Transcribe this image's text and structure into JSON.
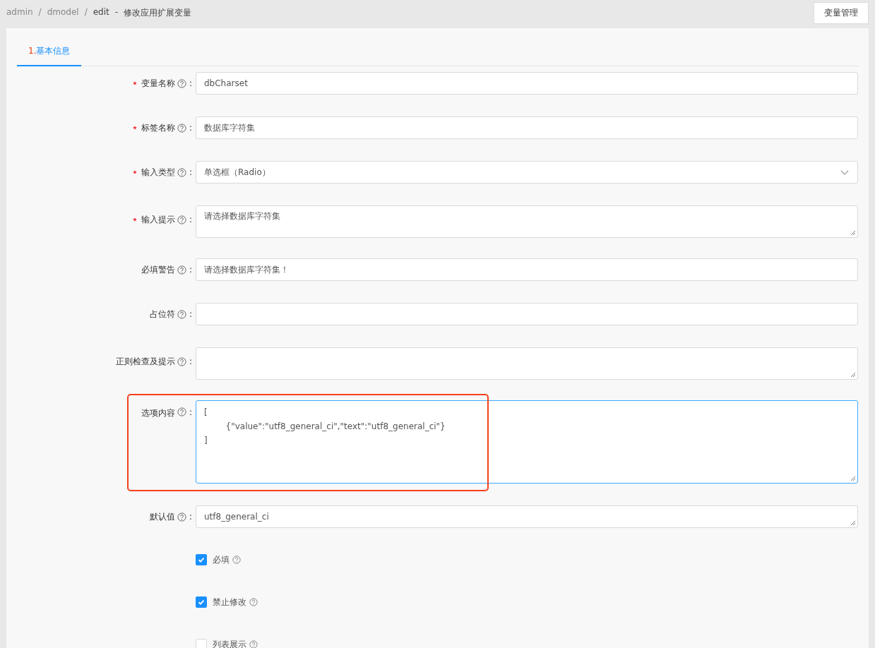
{
  "breadcrumb": {
    "items": [
      "admin",
      "dmodel",
      "edit"
    ],
    "separator": "/",
    "title_separator": "-",
    "title": "修改应用扩展变量"
  },
  "top_button": "变量管理",
  "label_suffix": ":",
  "tabs": [
    {
      "number": "1.",
      "label": "基本信息",
      "selected": true
    }
  ],
  "fields": [
    {
      "kind": "input",
      "label": "变量名称",
      "required": true,
      "value": "dbCharset",
      "focused": false,
      "annotated": false
    },
    {
      "kind": "input",
      "label": "标签名称",
      "required": true,
      "value": "数据库字符集",
      "focused": false,
      "annotated": false
    },
    {
      "kind": "select",
      "label": "输入类型",
      "required": true,
      "value": "单选框（Radio）",
      "focused": false,
      "annotated": false
    },
    {
      "kind": "textarea",
      "label": "输入提示",
      "required": true,
      "value": "请选择数据库字符集",
      "focused": false,
      "annotated": false
    },
    {
      "kind": "input",
      "label": "必填警告",
      "required": false,
      "value": "请选择数据库字符集！",
      "focused": false,
      "annotated": false
    },
    {
      "kind": "input",
      "label": "占位符",
      "required": false,
      "focused": false,
      "annotated": false
    },
    {
      "kind": "textarea",
      "label": "正则检查及提示",
      "required": false,
      "focused": false,
      "annotated": false
    },
    {
      "kind": "code",
      "label": "选项内容",
      "required": false,
      "lines": [
        "[",
        "        {\"value\":\"utf8_general_ci\",\"text\":\"utf8_general_ci\"}",
        "]"
      ],
      "focused": true,
      "annotated": true
    },
    {
      "kind": "textarea-short",
      "label": "默认值",
      "required": false,
      "value": "utf8_general_ci",
      "focused": false,
      "annotated": false
    }
  ],
  "checkboxes": [
    {
      "label": "必填",
      "checked": true
    },
    {
      "label": "禁止修改",
      "checked": true
    },
    {
      "label": "列表展示",
      "checked": false
    }
  ]
}
